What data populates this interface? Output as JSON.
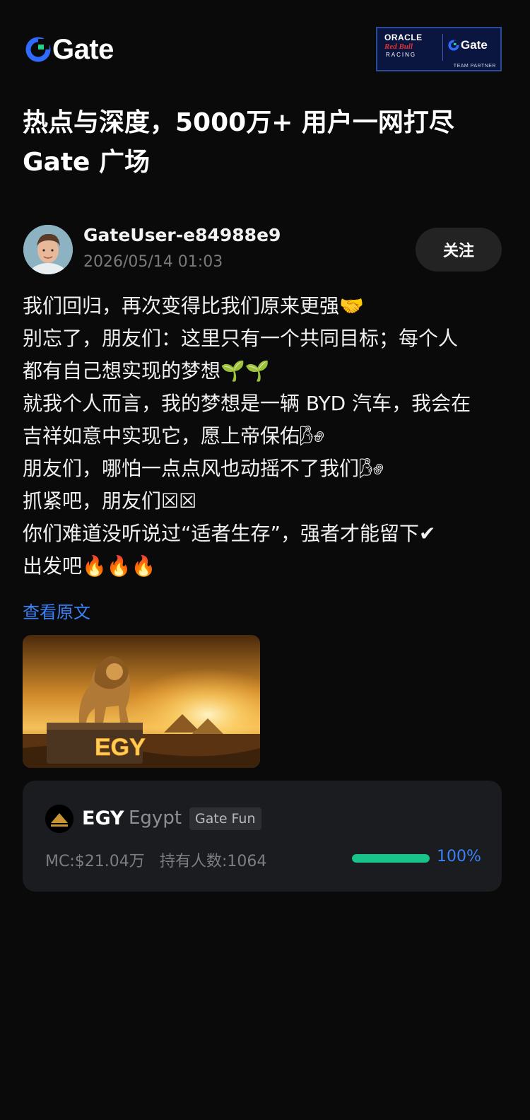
{
  "brand": {
    "logo_text": "Gate",
    "partner": {
      "line1": "ORACLE",
      "line2": "Red Bull",
      "line3": "RACING",
      "gate": "Gate",
      "tag": "TEAM PARTNER"
    }
  },
  "headline": {
    "line1": "热点与深度，5000万+ 用户一网打尽",
    "line2": "Gate 广场"
  },
  "post": {
    "username": "GateUser-e84988e9",
    "timestamp": "2026/05/14 01:03",
    "follow_label": "关注",
    "lines": [
      "我们回归，再次变得比我们原来更强🤝",
      "别忘了，朋友们：这里只有一个共同目标；每个人",
      "都有自己想实现的梦想🌱🌱",
      "就我个人而言，我的梦想是一辆 BYD 汽车，我会在",
      "吉祥如意中实现它，愿上帝保佑🌬",
      "朋友们，哪怕一点点风也动摇不了我们🌬",
      "抓紧吧，朋友们☒☒",
      "你们难道没听说过“适者生存”，强者才能留下✔",
      "出发吧🔥🔥🔥"
    ],
    "view_original": "查看原文",
    "image_text": "EGY"
  },
  "token": {
    "symbol": "EGY",
    "name": "Egypt",
    "badge": "Gate Fun",
    "market_cap": "MC:$21.04万",
    "holders": "持有人数:1064",
    "progress": 1.0,
    "progress_label": "100%",
    "progress_color": "#19c38a",
    "accent_color": "#3a82f7"
  }
}
